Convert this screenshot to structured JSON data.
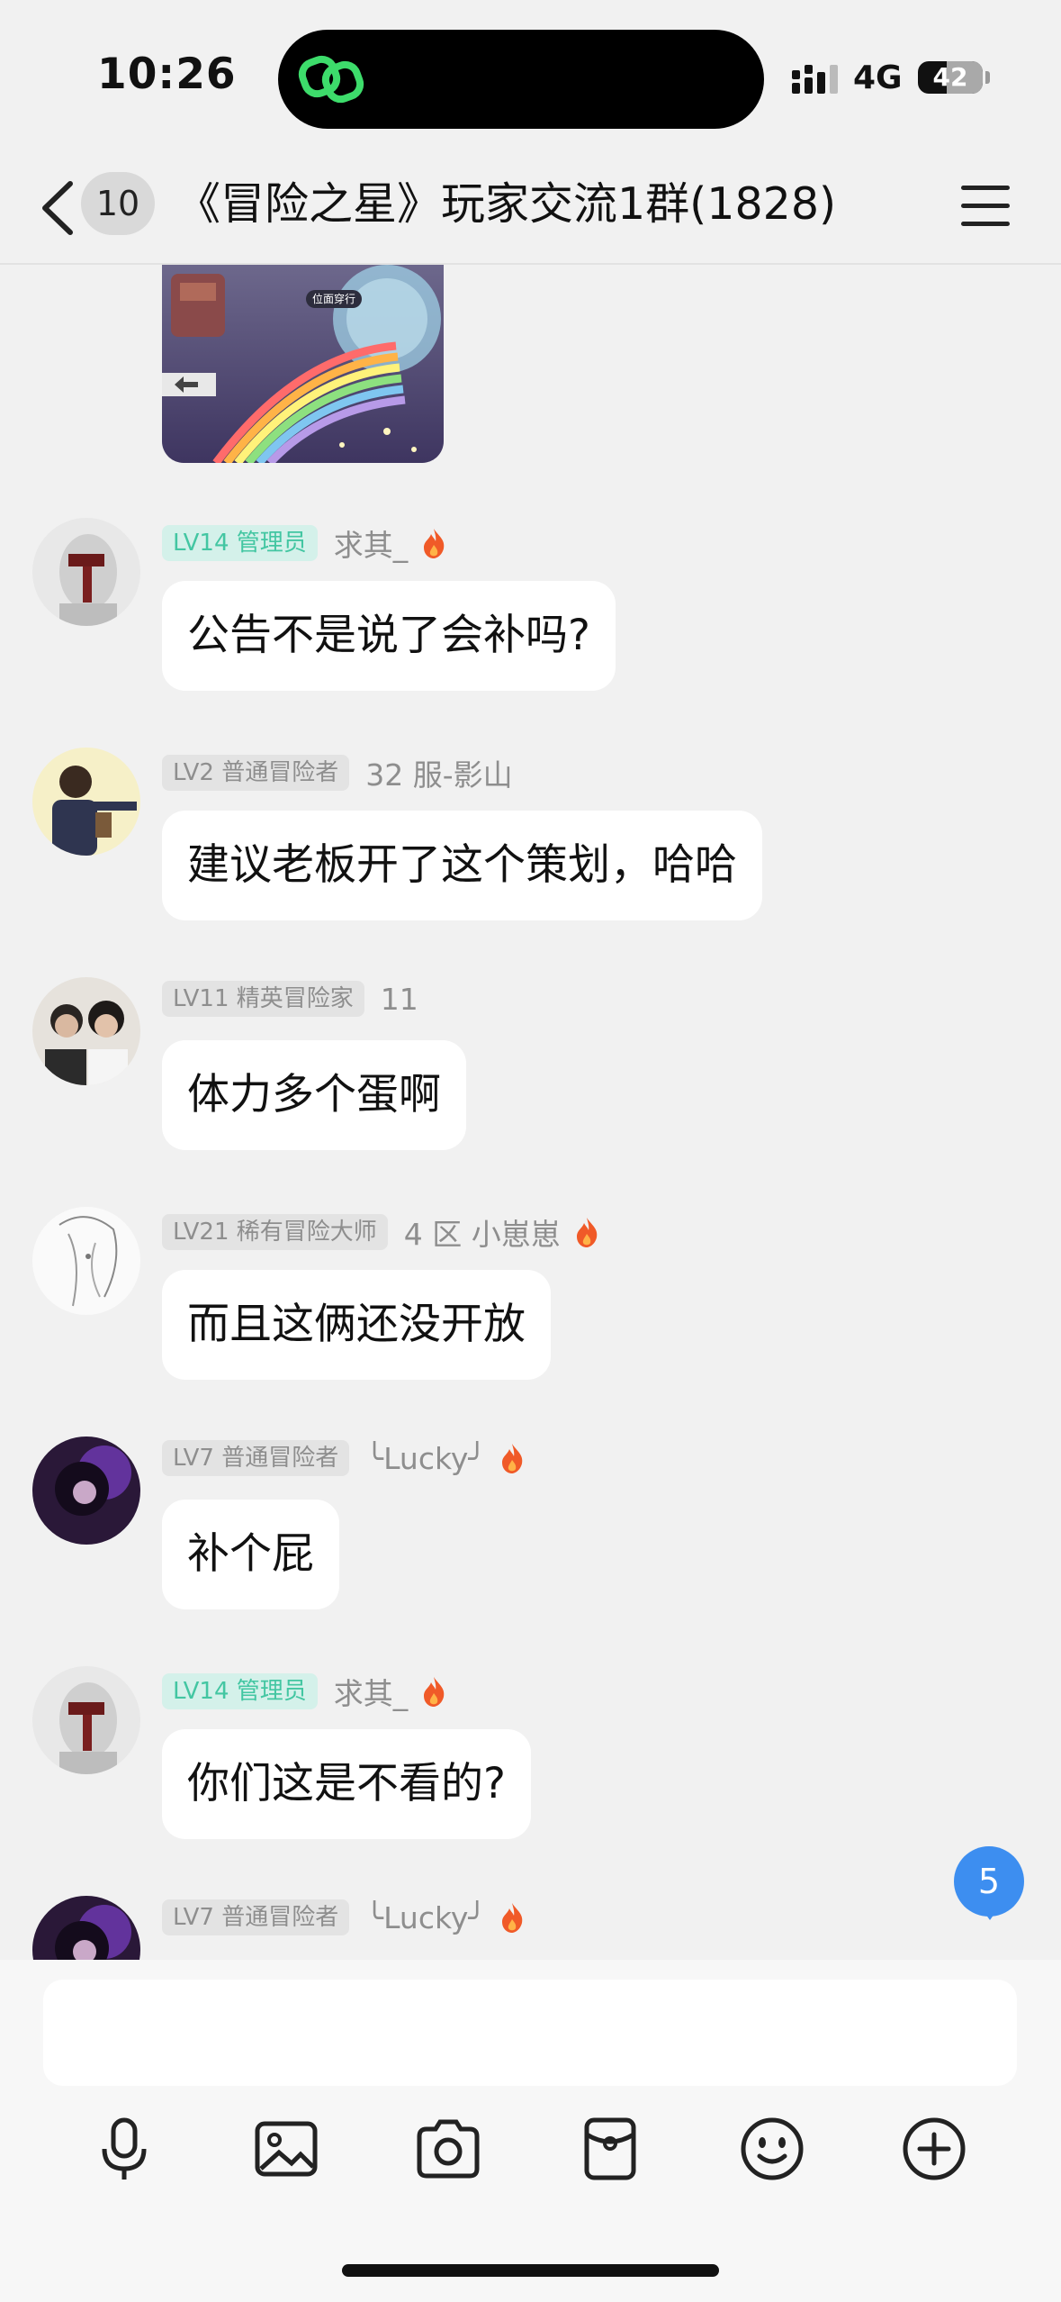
{
  "status_bar": {
    "time": "10:26",
    "network": "4G",
    "battery": "42"
  },
  "nav": {
    "unread_count": "10",
    "title": "《冒险之星》玩家交流1群(1828)"
  },
  "image_message": {
    "caption": "位面穿行"
  },
  "messages": [
    {
      "badge": "LV14 管理员",
      "badge_type": "admin",
      "nick": "求其_",
      "flame": true,
      "text": "公告不是说了会补吗?"
    },
    {
      "badge": "LV2 普通冒险者",
      "badge_type": "normal",
      "nick": "32 服-影山",
      "flame": false,
      "text": "建议老板开了这个策划，哈哈"
    },
    {
      "badge": "LV11 精英冒险家",
      "badge_type": "normal",
      "nick": "11",
      "flame": false,
      "text": "体力多个蛋啊"
    },
    {
      "badge": "LV21 稀有冒险大师",
      "badge_type": "normal",
      "nick": "4 区 小崽崽",
      "flame": true,
      "text": "而且这俩还没开放"
    },
    {
      "badge": "LV7 普通冒险者",
      "badge_type": "normal",
      "nick": "╰Lucky╯",
      "flame": true,
      "text": "补个屁"
    },
    {
      "badge": "LV14 管理员",
      "badge_type": "admin",
      "nick": "求其_",
      "flame": true,
      "text": "你们这是不看的?"
    },
    {
      "badge": "LV7 普通冒险者",
      "badge_type": "normal",
      "nick": "╰Lucky╯",
      "flame": true,
      "text": ""
    }
  ],
  "new_message_count": "5",
  "composer": {
    "value": "",
    "placeholder": ""
  },
  "toolbar": [
    "microphone-icon",
    "image-icon",
    "camera-icon",
    "red-packet-icon",
    "emoji-icon",
    "plus-icon"
  ],
  "colors": {
    "admin_badge_bg": "#d4f1ea",
    "admin_badge_text": "#43c6a2",
    "accent_blue": "#3d8ef0"
  }
}
